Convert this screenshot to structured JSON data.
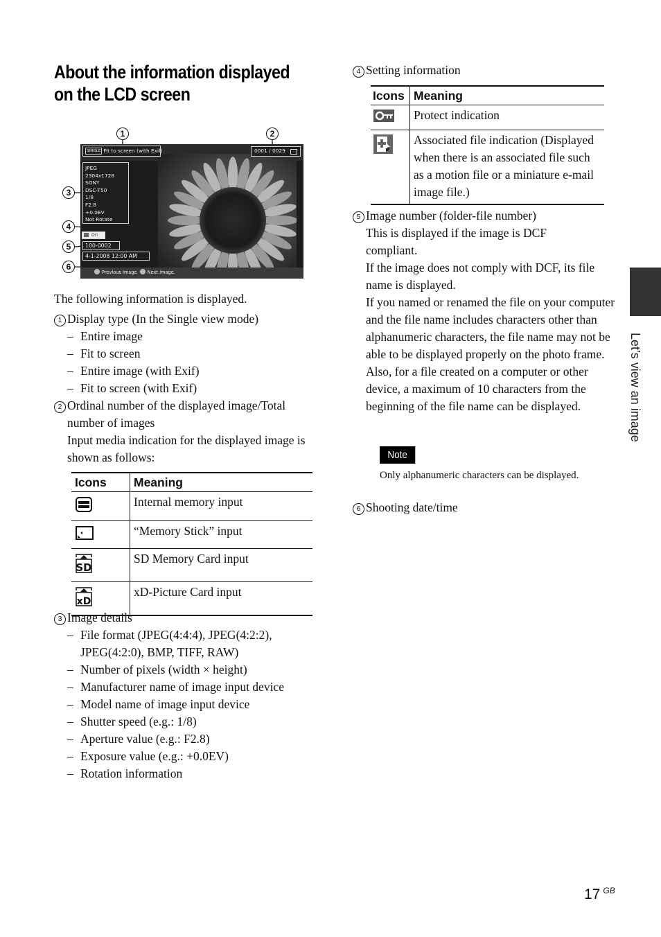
{
  "page": {
    "title_line1": "About the information displayed",
    "title_line2": "on the LCD screen",
    "page_number": "17",
    "page_suffix": "GB",
    "side_tab_label": "Let’s view an image"
  },
  "lcd_illustration": {
    "callouts": [
      "1",
      "2",
      "3",
      "4",
      "5",
      "6"
    ],
    "display_mode_chip": "SINGLE",
    "display_type": "Fit to screen (with Exif)",
    "image_counter": "0001 / 0029",
    "media_icon": "memory-stick-icon",
    "exif_lines": [
      "JPEG",
      "2304x1728",
      "SONY",
      "DSC-T50",
      "1/8",
      "F2.8",
      "+0.0EV",
      "Not Rotate"
    ],
    "setting_icons": [
      "associated-file-icon",
      "protect-key-icon"
    ],
    "image_number": "100-0002",
    "datetime": "4-1-2008 12:00 AM",
    "nav_previous": "Previous Image",
    "nav_next": "Next image."
  },
  "intro": "The following information is displayed.",
  "items": {
    "item1": {
      "number": "1",
      "heading": "Display type (In the Single view mode)",
      "bullets": [
        "Entire image",
        "Fit to screen",
        "Entire image (with Exif)",
        "Fit to screen (with Exif)"
      ]
    },
    "item2": {
      "number": "2",
      "heading_line1": "Ordinal number of the displayed image/Total",
      "heading_line2": "number of images",
      "para": "Input media indication for the displayed image is shown as follows:",
      "table": {
        "headers": [
          "Icons",
          "Meaning"
        ],
        "rows": [
          {
            "icon": "internal-memory-icon",
            "meaning": "Internal memory input"
          },
          {
            "icon": "memory-stick-icon",
            "meaning": "“Memory Stick” input"
          },
          {
            "icon": "sd-card-icon",
            "icon_text": "SD",
            "meaning": "SD Memory Card input"
          },
          {
            "icon": "xd-card-icon",
            "icon_text": "xD",
            "meaning": "xD-Picture Card input"
          }
        ]
      }
    },
    "item3": {
      "number": "3",
      "heading": "Image details",
      "bullets": [
        "File format (JPEG(4:4:4), JPEG(4:2:2), JPEG(4:2:0), BMP, TIFF, RAW)",
        "Number of pixels (width × height)",
        "Manufacturer name of image input device",
        "Model name of image input device",
        "Shutter speed (e.g.: 1/8)",
        "Aperture value (e.g.: F2.8)",
        "Exposure value (e.g.: +0.0EV)",
        "Rotation information"
      ]
    },
    "item4": {
      "number": "4",
      "heading": "Setting information",
      "table": {
        "headers": [
          "Icons",
          "Meaning"
        ],
        "rows": [
          {
            "icon": "protect-key-icon",
            "meaning": "Protect indication"
          },
          {
            "icon": "associated-file-icon",
            "meaning": "Associated file indication (Displayed when there is an associated file such as a motion file or a miniature e-mail image file.)"
          }
        ]
      }
    },
    "item5": {
      "number": "5",
      "heading": "Image number (folder-file number)",
      "paras": [
        "This is displayed if the image is DCF compliant.",
        "If the image does not comply with DCF, its file name is displayed.",
        "If you named or renamed the file on your computer and the file name includes characters other than alphanumeric characters, the file name may not be able to be displayed properly on the photo frame. Also, for a file created on a computer or other device, a maximum of 10 characters from the beginning of the file name can be displayed."
      ],
      "note_label": "Note",
      "note_text": "Only alphanumeric characters can be displayed."
    },
    "item6": {
      "number": "6",
      "heading": "Shooting date/time"
    }
  }
}
